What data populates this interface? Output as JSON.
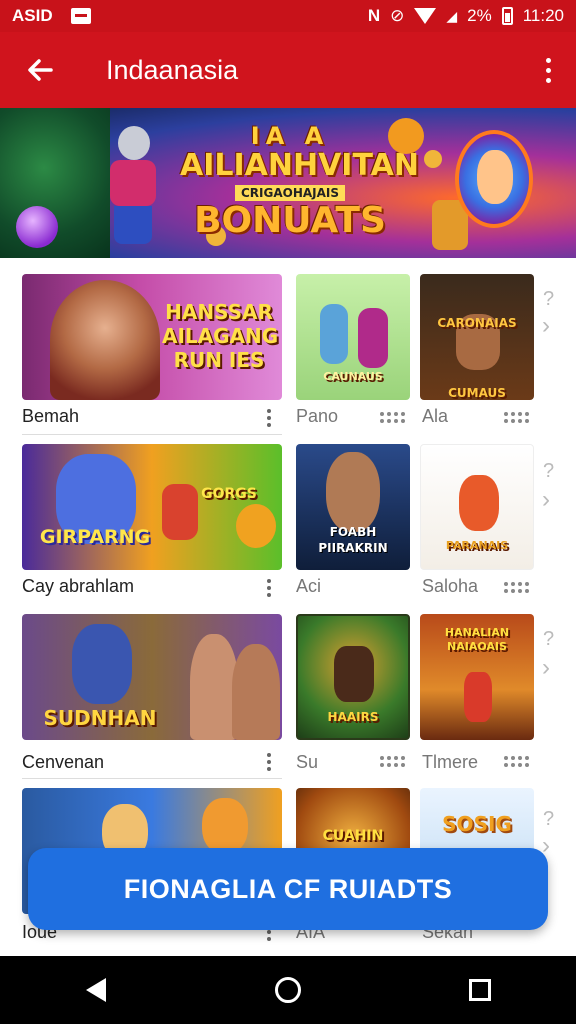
{
  "status_bar": {
    "left_text": "ASID",
    "battery_text": "%",
    "battery_prefix": "2",
    "time": "11:20",
    "icons": [
      "screen-icon",
      "nfc-icon",
      "alarm-icon",
      "wifi-icon",
      "signal-icon",
      "battery-icon"
    ]
  },
  "app_bar": {
    "title": "Indaanasia",
    "back_icon": "arrow-left-icon",
    "menu_icon": "more-vert-icon"
  },
  "banner": {
    "line1": "IA  A",
    "line2": "AILIANHVITAN",
    "line3": "CRIGAOHAJAIS",
    "line4": "BONUATS"
  },
  "rows": [
    {
      "big": {
        "art_text": "HANSSAR AILAGANG RUN IES",
        "label": "Bemah"
      },
      "small1": {
        "art_text": "CAUNAUS",
        "label": "Pano"
      },
      "small2": {
        "art_text": "CARONAIAS CUMAUS",
        "label": "Ala"
      }
    },
    {
      "big": {
        "art_text": "GIRPARNG",
        "art_text2": "GORGS",
        "label": "Cay abrahlam"
      },
      "small1": {
        "art_text": "FOABH PIIRAKRIN",
        "label": "Aci"
      },
      "small2": {
        "art_text": "PARANAIS",
        "label": "Saloha"
      }
    },
    {
      "big": {
        "art_text": "SUDNHAN",
        "label": "Cenvenan"
      },
      "small1": {
        "art_text": "HAAIRS",
        "label": "Su"
      },
      "small2": {
        "art_text": "HANALIAN NAIAOAIS",
        "label": "Tlmere"
      }
    },
    {
      "big": {
        "art_text": "",
        "label": "Ioue"
      },
      "small1": {
        "art_text": "CUAHIN",
        "label": "AIA"
      },
      "small2": {
        "art_text": "SOSIG",
        "label": "Sekan"
      }
    }
  ],
  "side_marks": {
    "q": "?",
    "chevron": "›"
  },
  "cta": {
    "label": "FIONAGLIA CF RUIADTS"
  },
  "colors": {
    "brand_red": "#d0141d",
    "cta_blue": "#1f6fe0"
  }
}
